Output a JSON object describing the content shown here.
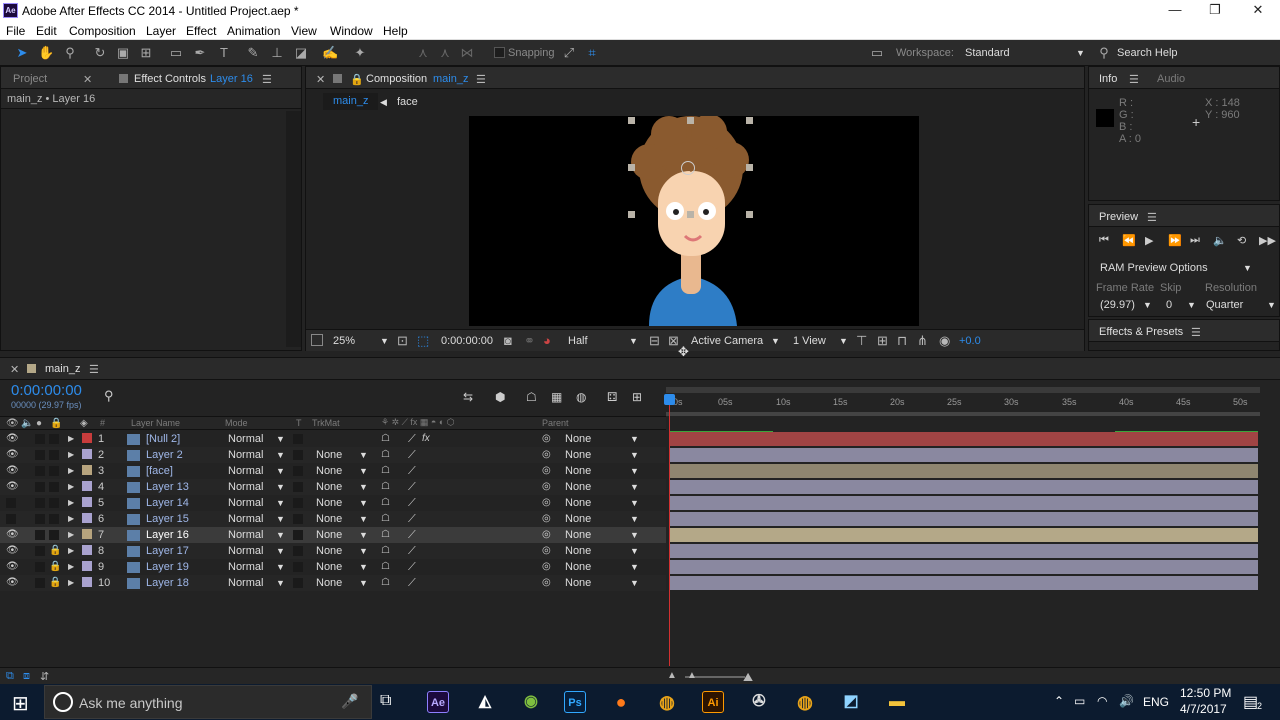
{
  "window": {
    "app_icon_text": "Ae",
    "title": "Adobe After Effects CC 2014 - Untitled Project.aep *",
    "minimize": "—",
    "maximize": "❐",
    "close": "✕"
  },
  "menu": [
    "File",
    "Edit",
    "Composition",
    "Layer",
    "Effect",
    "Animation",
    "View",
    "Window",
    "Help"
  ],
  "toolbar": {
    "snapping": "Snapping",
    "workspace_label": "Workspace:",
    "workspace_value": "Standard",
    "search_help": "Search Help"
  },
  "left_panel": {
    "tab_project": "Project",
    "tab_effect_controls": "Effect Controls",
    "effect_controls_layer": "Layer 16",
    "breadcrumb": "main_z • Layer 16"
  },
  "comp_panel": {
    "tab_label": "Composition",
    "tab_comp_name": "main_z",
    "breadcrumb_main": "main_z",
    "breadcrumb_child": "face",
    "zoom": "25%",
    "timecode": "0:00:00:00",
    "resolution": "Half",
    "camera": "Active Camera",
    "views": "1 View",
    "exposure": "+0.0"
  },
  "info_panel": {
    "tab_info": "Info",
    "tab_audio": "Audio",
    "r": "R :",
    "g": "G :",
    "b": "B :",
    "a": "A : 0",
    "x": "X : 148",
    "y": "Y : 960"
  },
  "preview_panel": {
    "title": "Preview",
    "ram_options": "RAM Preview Options",
    "frame_rate_label": "Frame Rate",
    "skip_label": "Skip",
    "resolution_label": "Resolution",
    "frame_rate_value": "(29.97)",
    "skip_value": "0",
    "resolution_value": "Quarter"
  },
  "effects_panel": {
    "title": "Effects & Presets"
  },
  "timeline": {
    "tab_name": "main_z",
    "timecode": "0:00:00:00",
    "frame_info": "00000 (29.97 fps)",
    "col_hash": "#",
    "col_layer_name": "Layer Name",
    "col_mode": "Mode",
    "col_t": "T",
    "col_trkmat": "TrkMat",
    "col_parent": "Parent",
    "ruler_ticks": [
      "0s",
      "05s",
      "10s",
      "15s",
      "20s",
      "25s",
      "30s",
      "35s",
      "40s",
      "45s",
      "50s"
    ],
    "layers": [
      {
        "num": "1",
        "name": "[Null 2]",
        "mode": "Normal",
        "trkmat": "",
        "parent": "None",
        "color": "#c83c3c",
        "track": "#a14444",
        "eye": true,
        "lock": false
      },
      {
        "num": "2",
        "name": "Layer 2",
        "mode": "Normal",
        "trkmat": "None",
        "parent": "None",
        "color": "#a9a2cf",
        "track": "#8a88a0",
        "eye": true,
        "lock": false
      },
      {
        "num": "3",
        "name": "[face]",
        "mode": "Normal",
        "trkmat": "None",
        "parent": "None",
        "color": "#b7a47e",
        "track": "#8f8670",
        "eye": true,
        "lock": false
      },
      {
        "num": "4",
        "name": "Layer 13",
        "mode": "Normal",
        "trkmat": "None",
        "parent": "None",
        "color": "#a9a2cf",
        "track": "#8a88a0",
        "eye": true,
        "lock": false
      },
      {
        "num": "5",
        "name": "Layer 14",
        "mode": "Normal",
        "trkmat": "None",
        "parent": "None",
        "color": "#a9a2cf",
        "track": "#8a88a0",
        "eye": false,
        "lock": false
      },
      {
        "num": "6",
        "name": "Layer 15",
        "mode": "Normal",
        "trkmat": "None",
        "parent": "None",
        "color": "#a9a2cf",
        "track": "#8a88a0",
        "eye": false,
        "lock": false
      },
      {
        "num": "7",
        "name": "Layer 16",
        "mode": "Normal",
        "trkmat": "None",
        "parent": "None",
        "color": "#b7a47e",
        "track": "#b4a888",
        "eye": true,
        "lock": false
      },
      {
        "num": "8",
        "name": "Layer 17",
        "mode": "Normal",
        "trkmat": "None",
        "parent": "None",
        "color": "#a9a2cf",
        "track": "#8a88a0",
        "eye": true,
        "lock": true
      },
      {
        "num": "9",
        "name": "Layer 19",
        "mode": "Normal",
        "trkmat": "None",
        "parent": "None",
        "color": "#a9a2cf",
        "track": "#8a88a0",
        "eye": true,
        "lock": true
      },
      {
        "num": "10",
        "name": "Layer 18",
        "mode": "Normal",
        "trkmat": "None",
        "parent": "None",
        "color": "#a9a2cf",
        "track": "#8a88a0",
        "eye": true,
        "lock": true
      }
    ]
  },
  "taskbar": {
    "search_placeholder": "Ask me anything",
    "lang": "ENG",
    "time": "12:50 PM",
    "date": "4/7/2017",
    "notif_count": "2",
    "app_ae": "Ae",
    "app_ps": "Ps",
    "app_ai": "Ai"
  }
}
